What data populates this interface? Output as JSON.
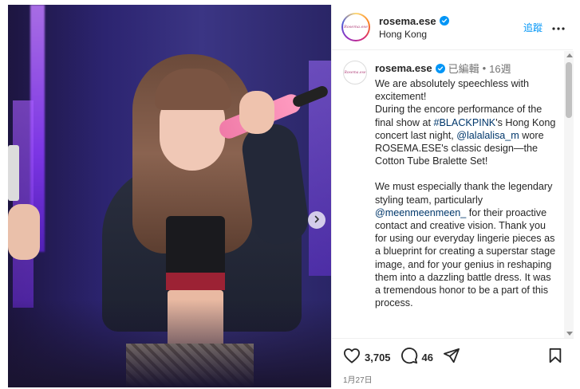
{
  "account": {
    "username": "rosema.ese",
    "location": "Hong Kong",
    "follow_label": "追蹤",
    "logo_text": "Rosema.ese"
  },
  "caption": {
    "username": "rosema.ese",
    "edited_label": "已編輯",
    "separator": "•",
    "age": "16週",
    "p1_line1": "We are absolutely speechless with excitement!",
    "p1_line2_pre": "During the encore performance of the final show at ",
    "p1_hashtag": "#BLACKPINK",
    "p1_line2_post": "'s Hong Kong concert last night, ",
    "p1_mention": "@lalalalisa_m",
    "p1_line3": " wore ROSEMA.ESE's classic design—the Cotton Tube Bralette Set!",
    "p2_pre": "We must especially thank the legendary styling team, particularly ",
    "p2_mention": "@meenmeenmeen_",
    "p2_post": " for their proactive contact and creative vision. Thank you for using our everyday lingerie pieces as a blueprint for creating a superstar stage image, and for your genius in reshaping them into a dazzling battle dress. It was a tremendous honor to be a part of this process."
  },
  "actions": {
    "likes": "3,705",
    "comments": "46",
    "date": "1月27日"
  },
  "icons": {
    "verified": "verified-badge-icon",
    "more": "more-options-icon",
    "like": "heart-icon",
    "comment": "comment-bubble-icon",
    "share": "share-icon",
    "save": "bookmark-icon",
    "next": "chevron-right-icon"
  },
  "colors": {
    "accent": "#0095f6",
    "link": "#00376b",
    "text": "#262626",
    "muted": "#737373"
  }
}
